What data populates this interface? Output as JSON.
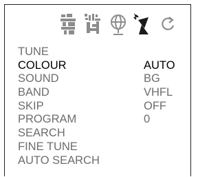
{
  "toolbar": {
    "icons": [
      "picture-settings-icon",
      "sound-settings-icon",
      "globe-icon",
      "antenna-icon",
      "refresh-icon"
    ]
  },
  "menu": {
    "items": [
      {
        "label": "TUNE",
        "value": ""
      },
      {
        "label": "COLOUR",
        "value": "AUTO"
      },
      {
        "label": "SOUND",
        "value": "BG"
      },
      {
        "label": "BAND",
        "value": "VHFL"
      },
      {
        "label": "SKIP",
        "value": "OFF"
      },
      {
        "label": "PROGRAM",
        "value": "0"
      },
      {
        "label": "SEARCH",
        "value": ""
      },
      {
        "label": "FINE TUNE",
        "value": ""
      },
      {
        "label": "AUTO SEARCH",
        "value": ""
      }
    ]
  },
  "colors": {
    "text_active": "#000000",
    "text_inactive": "#6d6d6d",
    "icon_gray": "#8c8c8c",
    "icon_active": "#1a1a1a"
  }
}
